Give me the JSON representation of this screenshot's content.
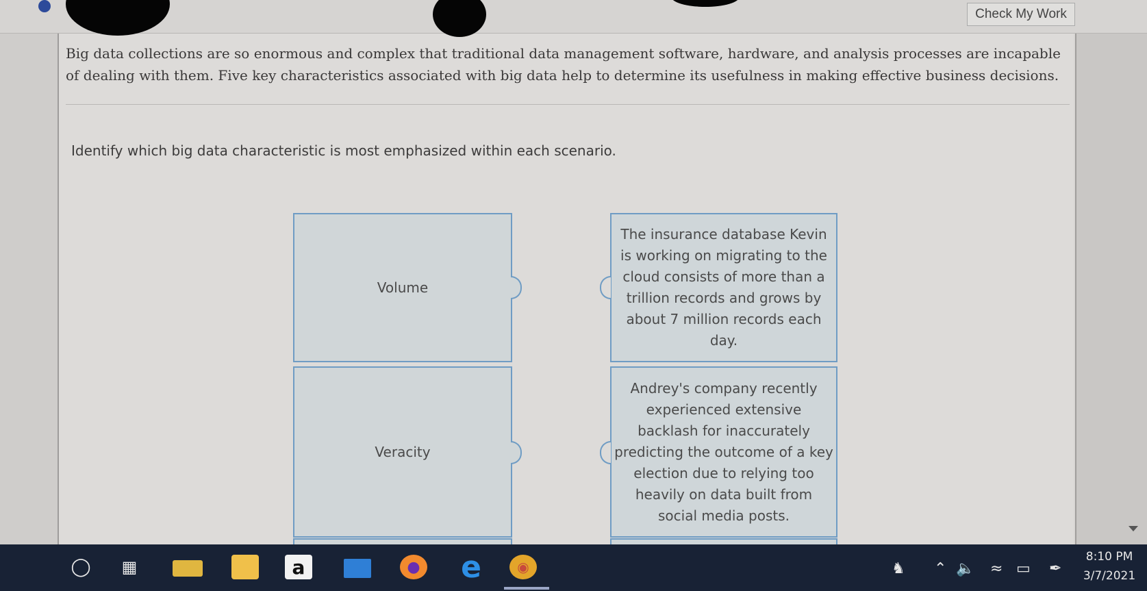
{
  "header": {
    "check_button_label": "Check My Work"
  },
  "question": {
    "intro": "Big data collections are so enormous and complex that traditional data management software, hardware, and analysis processes are incapable of dealing with them. Five key characteristics associated with big data help to determine its usefulness in making effective business decisions.",
    "instruction": "Identify which big data characteristic is most emphasized within each scenario."
  },
  "matches": [
    {
      "term": "Volume",
      "scenario": "The insurance database Kevin is working on migrating to the cloud consists of more than a trillion records and grows by about 7 million records each day."
    },
    {
      "term": "Veracity",
      "scenario": "Andrey's company recently experienced extensive backlash for inaccurately predicting the outcome of a key election due to relying too heavily on data built from social media posts."
    }
  ],
  "taskbar": {
    "apps": [
      "search-icon",
      "task-view-icon",
      "file-explorer-icon",
      "store-icon",
      "amazon-icon",
      "mail-icon",
      "firefox-icon",
      "edge-icon",
      "chrome-icon"
    ],
    "amazon_letter": "a",
    "time": "8:10 PM",
    "date": "3/7/2021"
  },
  "colors": {
    "tile_border": "#6f9cc4",
    "tile_fill": "#cfd6d9",
    "taskbar": "#182235"
  }
}
